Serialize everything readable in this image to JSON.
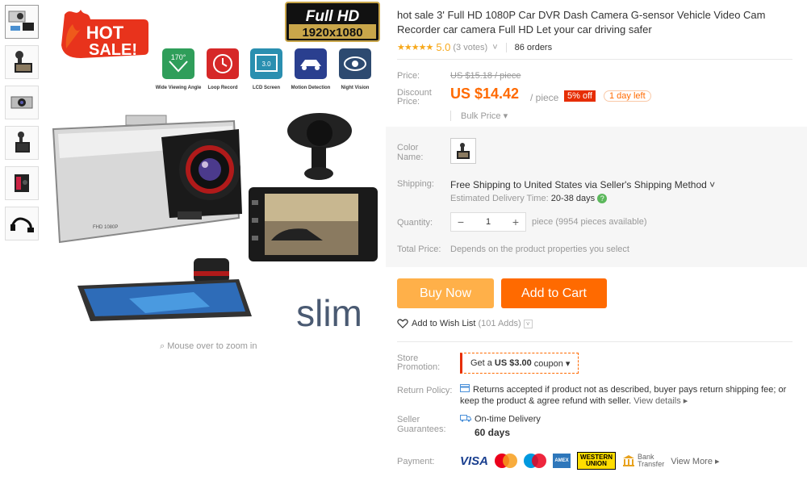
{
  "product": {
    "title": "hot sale 3' Full HD 1080P Car DVR Dash Camera G-sensor Vehicle Video Cam Recorder car camera Full HD Let your car driving safer",
    "rating": {
      "stars": "★★★★★",
      "score": "5.0",
      "votes": "(3 votes)",
      "orders": "86 orders"
    }
  },
  "image": {
    "hot_badge_line1": "HOT",
    "hot_badge_line2": "SALE!",
    "full_hd_line1": "Full HD",
    "full_hd_line2": "1920x1080",
    "features": [
      {
        "label": "Wide Viewing Angle",
        "icon": "angle-170-icon",
        "text": "170°"
      },
      {
        "label": "Loop Record",
        "icon": "loop-record-icon",
        "text": ""
      },
      {
        "label": "LCD Screen",
        "icon": "lcd-screen-icon",
        "text": "3.0"
      },
      {
        "label": "Motion Detection",
        "icon": "motion-detection-icon",
        "text": ""
      },
      {
        "label": "Night Vision",
        "icon": "night-vision-icon",
        "text": ""
      }
    ],
    "device_label": "FHD 1080P",
    "slim_text": "slim",
    "zoom_hint": "Mouse over to zoom in"
  },
  "price": {
    "label": "Price:",
    "original": "US $15.18 / piece",
    "discount_label_1": "Discount",
    "discount_label_2": "Price:",
    "discount": "US $14.42",
    "unit": "/ piece",
    "off_badge": "5% off",
    "time_badge": "1 day left",
    "bulk": "Bulk Price ▾"
  },
  "properties": {
    "color_label_1": "Color",
    "color_label_2": "Name:",
    "shipping_label": "Shipping:",
    "shipping_text": "Free Shipping to United States via Seller's Shipping Method ˅",
    "delivery_label": "Estimated Delivery Time:",
    "delivery_value": "20-38 days",
    "quantity_label": "Quantity:",
    "quantity_value": "1",
    "quantity_avail": "piece (9954 pieces available)",
    "total_label": "Total Price:",
    "total_text": "Depends on the product properties you select"
  },
  "actions": {
    "buy_now": "Buy Now",
    "add_to_cart": "Add to Cart",
    "wish_list": "Add to Wish List",
    "wish_count": "(101 Adds)"
  },
  "store": {
    "promo_label_1": "Store",
    "promo_label_2": "Promotion:",
    "coupon_pre": "Get a",
    "coupon_amount": "US $3.00",
    "coupon_post": "coupon ▾",
    "return_label": "Return Policy:",
    "return_text": "Returns accepted if product not as described, buyer pays return shipping fee; or keep the product & agree refund with seller.",
    "view_details": "View details ▸",
    "guarantee_label_1": "Seller",
    "guarantee_label_2": "Guarantees:",
    "guarantee_title": "On-time Delivery",
    "guarantee_days": "60 days",
    "payment_label": "Payment:",
    "visa": "VISA",
    "wu_1": "WESTERN",
    "wu_2": "UNION",
    "bank_1": "Bank",
    "bank_2": "Transfer",
    "view_more": "View More ▸"
  },
  "colors": {
    "accent": "#ff6a00",
    "buy_now": "#ffb049",
    "badge_red": "#e62e04",
    "star": "#f7a91c"
  }
}
